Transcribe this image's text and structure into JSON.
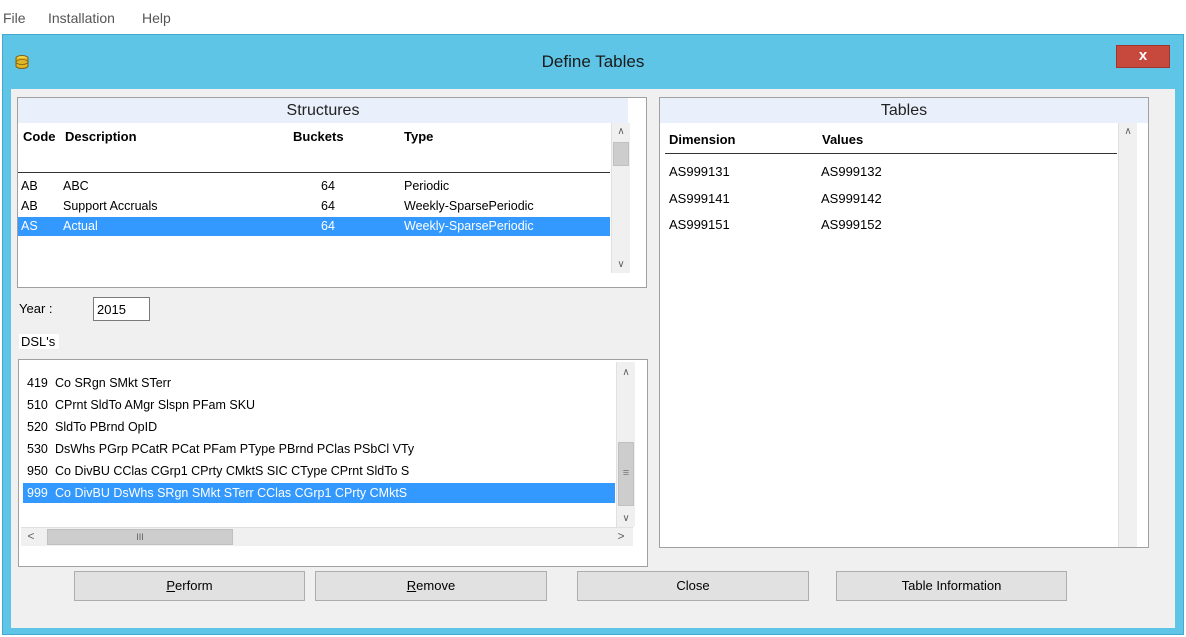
{
  "menu": {
    "items": [
      "File",
      "Installation",
      "Help"
    ]
  },
  "dialog": {
    "title": "Define Tables",
    "close_label": "x"
  },
  "structures": {
    "header": "Structures",
    "columns": {
      "code": "Code",
      "description": "Description",
      "buckets": "Buckets",
      "type": "Type"
    },
    "rows": [
      {
        "code": "AB",
        "description": "ABC",
        "buckets": "64",
        "type": "Periodic",
        "selected": false
      },
      {
        "code": "AB",
        "description": "Support Accruals",
        "buckets": "64",
        "type": "Weekly-SparsePeriodic",
        "selected": false
      },
      {
        "code": "AS",
        "description": "Actual",
        "buckets": "64",
        "type": "Weekly-SparsePeriodic",
        "selected": true
      }
    ]
  },
  "year": {
    "label": "Year :",
    "value": "2015"
  },
  "dsls": {
    "label": "DSL's",
    "rows": [
      {
        "code": "419",
        "text": "Co SRgn SMkt STerr",
        "selected": false
      },
      {
        "code": "510",
        "text": "CPrnt SldTo AMgr Slspn PFam SKU",
        "selected": false
      },
      {
        "code": "520",
        "text": "SldTo PBrnd OpID",
        "selected": false
      },
      {
        "code": "530",
        "text": "DsWhs PGrp PCatR PCat PFam PType PBrnd PClas PSbCl VTy",
        "selected": false
      },
      {
        "code": "950",
        "text": "Co DivBU CClas CGrp1 CPrty CMktS SIC CType CPrnt SldTo S",
        "selected": false
      },
      {
        "code": "999",
        "text": "Co DivBU DsWhs SRgn SMkt STerr CClas CGrp1 CPrty CMktS",
        "selected": true
      }
    ],
    "hscroll_grip": "III"
  },
  "tables": {
    "header": "Tables",
    "columns": {
      "dimension": "Dimension",
      "values": "Values"
    },
    "rows": [
      {
        "dimension": "AS999131",
        "values": "AS999132"
      },
      {
        "dimension": "AS999141",
        "values": "AS999142"
      },
      {
        "dimension": "AS999151",
        "values": "AS999152"
      }
    ]
  },
  "buttons": {
    "perform": {
      "hotkey": "P",
      "rest": "erform"
    },
    "remove": {
      "hotkey": "R",
      "rest": "emove"
    },
    "close": "Close",
    "table_info": "Table Information"
  },
  "colors": {
    "title_bar": "#5ec5e7",
    "selection": "#3399ff",
    "close_button": "#c7483c",
    "panel_header": "#e9f0fb"
  },
  "icons": {
    "app": "database-icon",
    "close": "close-icon",
    "up": "chevron-up-icon",
    "down": "chevron-down-icon",
    "left": "chevron-left-icon",
    "right": "chevron-right-icon"
  }
}
